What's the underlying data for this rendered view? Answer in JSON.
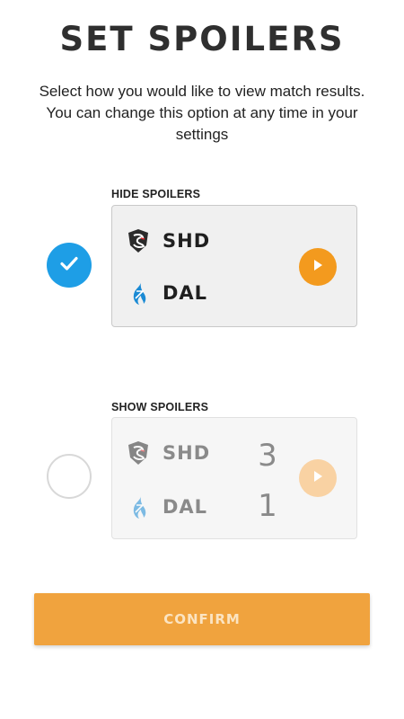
{
  "header": {
    "title": "SET SPOILERS",
    "subtitle": "Select how you would like to view match results. You can change this option at any time in your settings"
  },
  "options": [
    {
      "label": "HIDE SPOILERS",
      "selected": true,
      "teams": [
        {
          "abbr": "SHD",
          "logo": "dragon-logo-icon"
        },
        {
          "abbr": "DAL",
          "logo": "flame-logo-icon"
        }
      ]
    },
    {
      "label": "SHOW SPOILERS",
      "selected": false,
      "teams": [
        {
          "abbr": "SHD",
          "logo": "dragon-logo-icon",
          "score": "3"
        },
        {
          "abbr": "DAL",
          "logo": "flame-logo-icon",
          "score": "1"
        }
      ]
    }
  ],
  "confirm_label": "CONFIRM",
  "colors": {
    "accent_blue": "#1e9ee6",
    "play_orange": "#f39a1e",
    "confirm_orange": "#f0a33e",
    "dal_blue": "#1a8ad4"
  }
}
